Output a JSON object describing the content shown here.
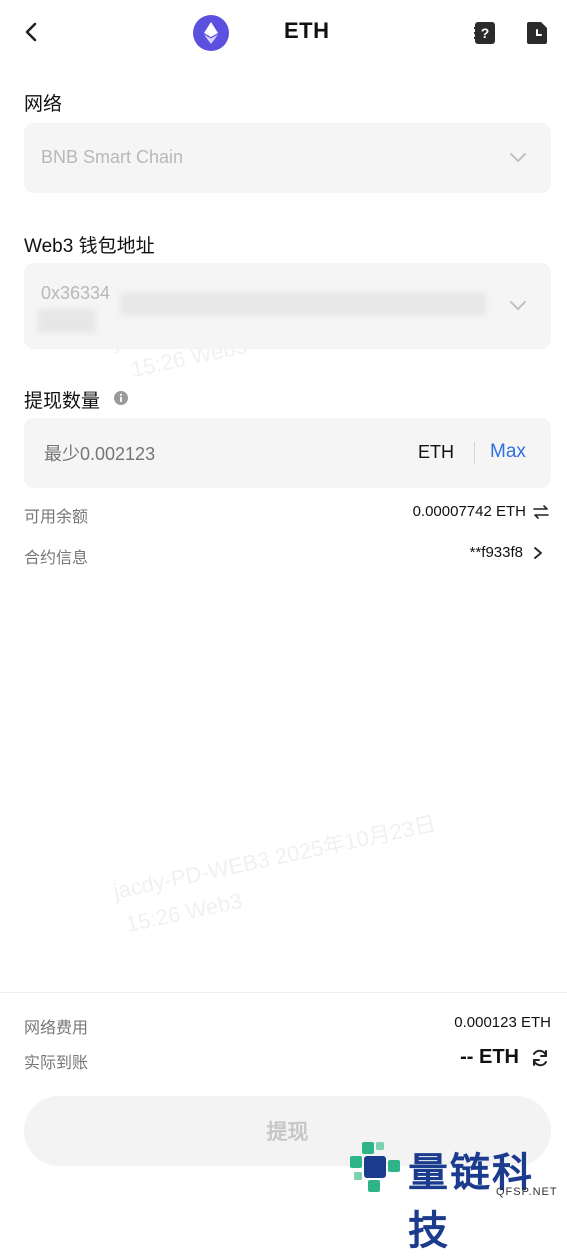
{
  "header": {
    "title": "ETH",
    "coin_icon": "ethereum-icon",
    "accent": "#5b50e0"
  },
  "network": {
    "label": "网络",
    "value": "BNB Smart Chain"
  },
  "address": {
    "label": "Web3 钱包地址",
    "value": "0x36334"
  },
  "amount": {
    "label": "提现数量",
    "placeholder": "最少0.002123",
    "unit": "ETH",
    "max_label": "Max",
    "max_color": "#2f6fe0"
  },
  "available": {
    "label": "可用余额",
    "value": "0.00007742 ETH"
  },
  "contract": {
    "label": "合约信息",
    "value": "**f933f8"
  },
  "fee": {
    "label": "网络费用",
    "value": "0.000123 ETH"
  },
  "received": {
    "label": "实际到账",
    "value": "-- ETH"
  },
  "submit": {
    "label": "提现"
  },
  "watermark": {
    "line1": "jacdy-PD-WEB3 2025年10月23日",
    "line2": "15:26 Web3"
  },
  "brand": {
    "name": "量链科技",
    "domain": "QFSP.NET"
  }
}
